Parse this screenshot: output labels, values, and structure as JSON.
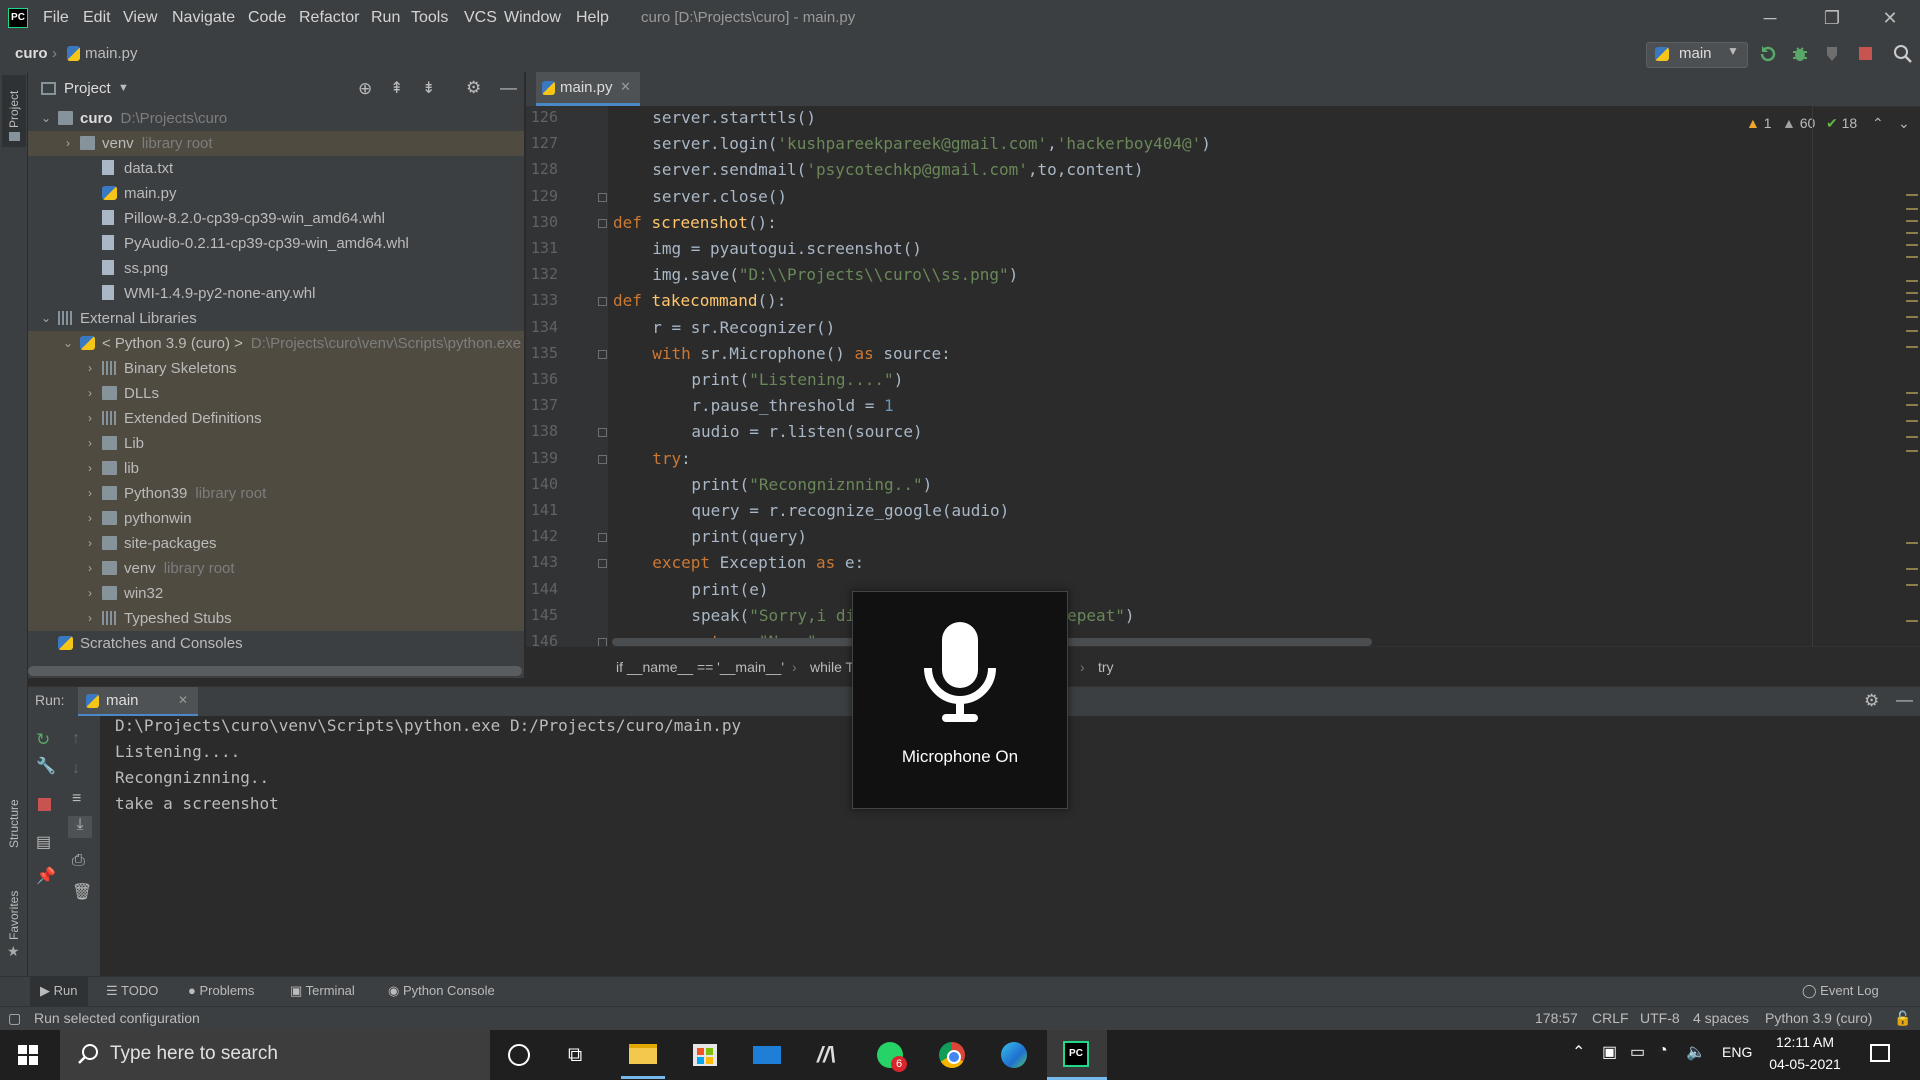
{
  "titlebar": {
    "menus": [
      "File",
      "Edit",
      "View",
      "Navigate",
      "Code",
      "Refactor",
      "Run",
      "Tools",
      "VCS",
      "Window",
      "Help"
    ],
    "title": "curo [D:\\Projects\\curo] - main.py",
    "min": "─",
    "max": "❐",
    "close": "✕"
  },
  "navbar": {
    "project": "curo",
    "file": "main.py",
    "run_config": "main"
  },
  "side_labels": {
    "project": "Project",
    "structure": "Structure",
    "favorites": "Favorites"
  },
  "project_panel": {
    "title": "Project",
    "tree": [
      {
        "label": "curo",
        "hint": "D:\\Projects\\curo",
        "indent": 0,
        "arrow": "⌄",
        "icon": "folder",
        "bold": true
      },
      {
        "label": "venv",
        "hint": "library root",
        "indent": 1,
        "arrow": "›",
        "icon": "folder",
        "hl": true
      },
      {
        "label": "data.txt",
        "hint": "",
        "indent": 2,
        "arrow": "",
        "icon": "file"
      },
      {
        "label": "main.py",
        "hint": "",
        "indent": 2,
        "arrow": "",
        "icon": "py"
      },
      {
        "label": "Pillow-8.2.0-cp39-cp39-win_amd64.whl",
        "hint": "",
        "indent": 2,
        "arrow": "",
        "icon": "file"
      },
      {
        "label": "PyAudio-0.2.11-cp39-cp39-win_amd64.whl",
        "hint": "",
        "indent": 2,
        "arrow": "",
        "icon": "file"
      },
      {
        "label": "ss.png",
        "hint": "",
        "indent": 2,
        "arrow": "",
        "icon": "file"
      },
      {
        "label": "WMI-1.4.9-py2-none-any.whl",
        "hint": "",
        "indent": 2,
        "arrow": "",
        "icon": "file"
      },
      {
        "label": "External Libraries",
        "hint": "",
        "indent": 0,
        "arrow": "⌄",
        "icon": "lib"
      },
      {
        "label": "< Python 3.9 (curo) >",
        "hint": "D:\\Projects\\curo\\venv\\Scripts\\python.exe",
        "indent": 1,
        "arrow": "⌄",
        "icon": "py",
        "hl": true
      },
      {
        "label": "Binary Skeletons",
        "hint": "",
        "indent": 2,
        "arrow": "›",
        "icon": "lib",
        "hl": true
      },
      {
        "label": "DLLs",
        "hint": "",
        "indent": 2,
        "arrow": "›",
        "icon": "folder",
        "hl": true
      },
      {
        "label": "Extended Definitions",
        "hint": "",
        "indent": 2,
        "arrow": "›",
        "icon": "lib",
        "hl": true
      },
      {
        "label": "Lib",
        "hint": "",
        "indent": 2,
        "arrow": "›",
        "icon": "folder",
        "hl": true
      },
      {
        "label": "lib",
        "hint": "",
        "indent": 2,
        "arrow": "›",
        "icon": "folder",
        "hl": true
      },
      {
        "label": "Python39",
        "hint": "library root",
        "indent": 2,
        "arrow": "›",
        "icon": "folder",
        "hl": true
      },
      {
        "label": "pythonwin",
        "hint": "",
        "indent": 2,
        "arrow": "›",
        "icon": "folder",
        "hl": true
      },
      {
        "label": "site-packages",
        "hint": "",
        "indent": 2,
        "arrow": "›",
        "icon": "folder",
        "hl": true
      },
      {
        "label": "venv",
        "hint": "library root",
        "indent": 2,
        "arrow": "›",
        "icon": "folder",
        "hl": true
      },
      {
        "label": "win32",
        "hint": "",
        "indent": 2,
        "arrow": "›",
        "icon": "folder",
        "hl": true
      },
      {
        "label": "Typeshed Stubs",
        "hint": "",
        "indent": 2,
        "arrow": "›",
        "icon": "lib",
        "hl": true
      },
      {
        "label": "Scratches and Consoles",
        "hint": "",
        "indent": 0,
        "arrow": "",
        "icon": "scratch"
      }
    ]
  },
  "editor": {
    "tab": "main.py",
    "inspections": {
      "warn1": "1",
      "warn2": "60",
      "ok": "18"
    },
    "lines": [
      {
        "n": "126",
        "indent": 2,
        "html": "server.starttls()"
      },
      {
        "n": "127",
        "indent": 2,
        "html": "server.login(<span class='str'>'kushpareekpareek@gmail.com'</span>,<span class='str'>'hackerboy404@'</span>)"
      },
      {
        "n": "128",
        "indent": 2,
        "html": "server.sendmail(<span class='str'>'psycotechkp@gmail.com'</span>,to,content)"
      },
      {
        "n": "129",
        "indent": 2,
        "html": "server.close()"
      },
      {
        "n": "130",
        "indent": 0,
        "html": "<span class='kw'>def</span> <span class='fn'>screenshot</span>():"
      },
      {
        "n": "131",
        "indent": 2,
        "html": "img = pyautogui.screenshot()"
      },
      {
        "n": "132",
        "indent": 2,
        "html": "img.save(<span class='str'>\"D:\\\\Projects\\\\curo\\\\ss.png\"</span>)"
      },
      {
        "n": "133",
        "indent": 0,
        "html": "<span class='kw'>def</span> <span class='fn'>takecommand</span>():"
      },
      {
        "n": "134",
        "indent": 2,
        "html": "r = sr.Recognizer()"
      },
      {
        "n": "135",
        "indent": 2,
        "html": "<span class='kw'>with</span> sr.Microphone() <span class='kw'>as</span> source:"
      },
      {
        "n": "136",
        "indent": 4,
        "html": "print(<span class='str'>\"Listening....\"</span>)"
      },
      {
        "n": "137",
        "indent": 4,
        "html": "r.pause_threshold = <span class='num'>1</span>"
      },
      {
        "n": "138",
        "indent": 4,
        "html": "audio = r.listen(source)"
      },
      {
        "n": "139",
        "indent": 2,
        "html": "<span class='kw'>try</span>:"
      },
      {
        "n": "140",
        "indent": 4,
        "html": "print(<span class='str'>\"Recongniznning..\"</span>)"
      },
      {
        "n": "141",
        "indent": 4,
        "html": "query = r.recognize_google(audio)"
      },
      {
        "n": "142",
        "indent": 4,
        "html": "print(query)"
      },
      {
        "n": "143",
        "indent": 2,
        "html": "<span class='kw'>except</span> Exception <span class='kw'>as</span> e:"
      },
      {
        "n": "144",
        "indent": 4,
        "html": "print(e)"
      },
      {
        "n": "145",
        "indent": 4,
        "html": "speak(<span class='str'>\"Sorry,i didn't get that please repeat\"</span>)"
      },
      {
        "n": "146",
        "indent": 4,
        "html": "<span class='kw'>return</span> <span class='str'>\"Noun\"</span>"
      }
    ],
    "breadcrumbs": [
      "if __name__ == '__main__'",
      "while True",
      "el",
      "ail' in query",
      "try"
    ]
  },
  "run_panel": {
    "label": "Run:",
    "tab": "main",
    "output": [
      "D:\\Projects\\curo\\venv\\Scripts\\python.exe D:/Projects/curo/main.py",
      "Listening....",
      "Recongniznning..",
      "take a screenshot"
    ]
  },
  "tool_tabs": [
    "Run",
    "TODO",
    "Problems",
    "Terminal",
    "Python Console"
  ],
  "event_log": "Event Log",
  "statusbar": {
    "message": "Run selected configuration",
    "position": "178:57",
    "line_sep": "CRLF",
    "encoding": "UTF-8",
    "indent": "4 spaces",
    "interpreter": "Python 3.9 (curo)"
  },
  "taskbar": {
    "search_placeholder": "Type here to search",
    "lang": "ENG",
    "time": "12:11 AM",
    "date": "04-05-2021",
    "whatsapp_badge": "6"
  },
  "mic_overlay": {
    "label": "Microphone On"
  },
  "colors": {
    "accent": "#4a88c7",
    "keyword": "#cc7832",
    "string": "#6a8759",
    "number": "#6897bb",
    "function": "#ffc66d"
  }
}
